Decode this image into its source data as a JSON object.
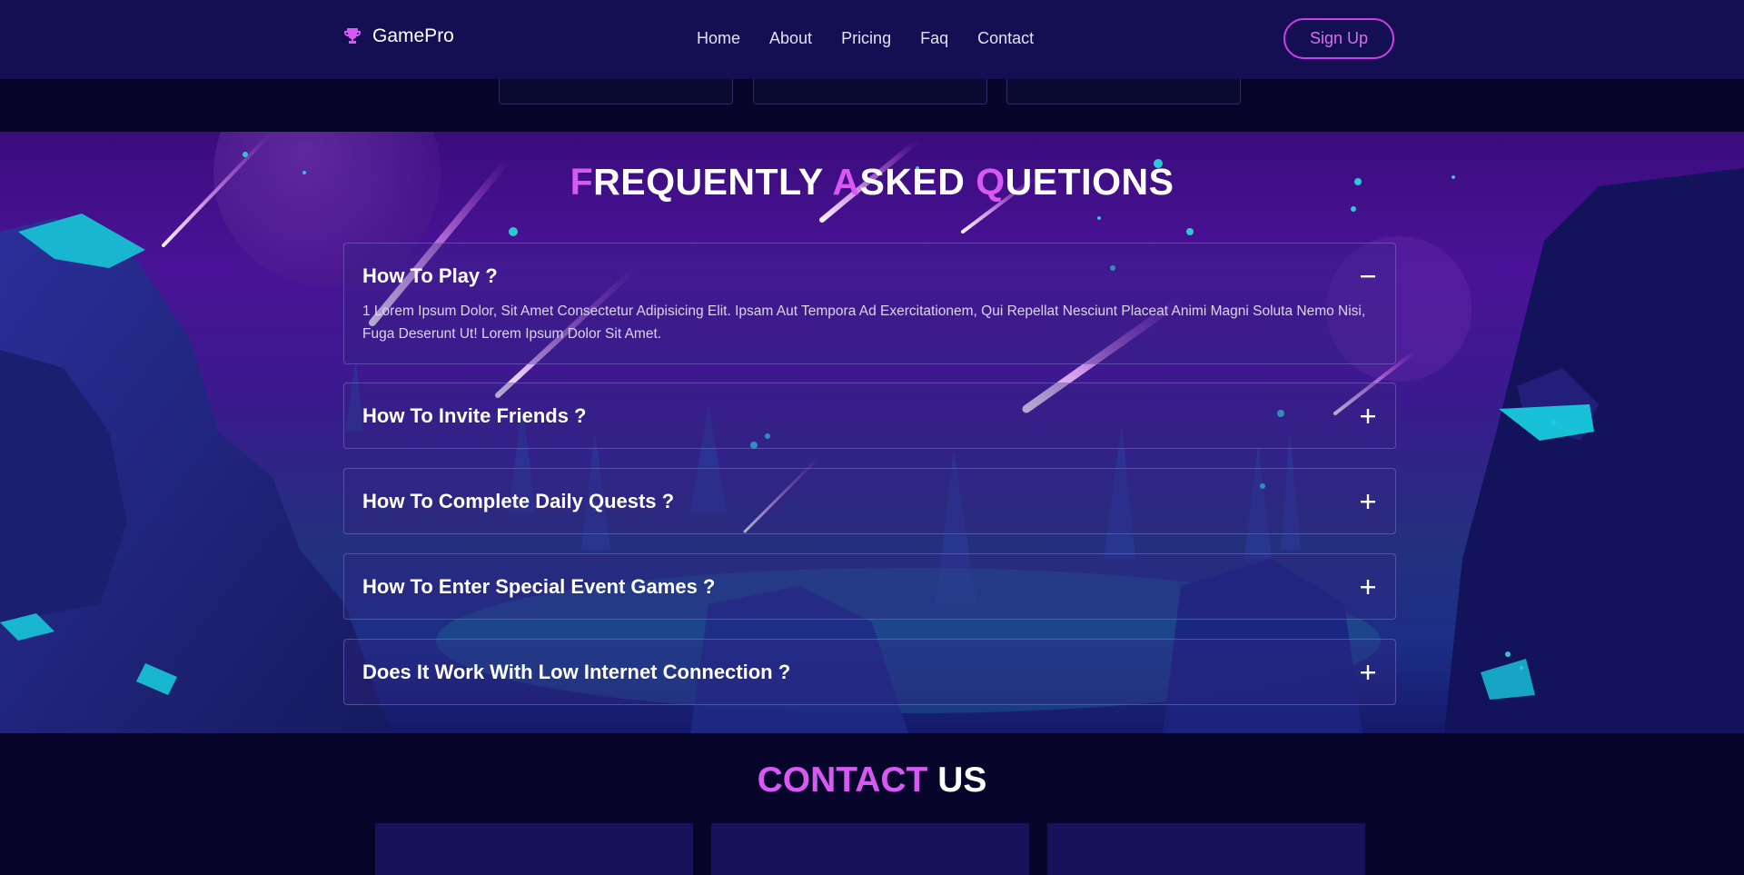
{
  "nav": {
    "brand": "GamePro",
    "logo_icon": "trophy-icon",
    "links": [
      "Home",
      "About",
      "Pricing",
      "Faq",
      "Contact"
    ],
    "signup_label": "Sign Up"
  },
  "faq": {
    "title_parts": [
      {
        "accent": "F",
        "rest": "REQUENTLY "
      },
      {
        "accent": "A",
        "rest": "SKED "
      },
      {
        "accent": "Q",
        "rest": "UETIONS"
      }
    ],
    "items": [
      {
        "question": "How To Play ?",
        "answer": "1 Lorem Ipsum Dolor, Sit Amet Consectetur Adipisicing Elit. Ipsam Aut Tempora Ad Exercitationem, Qui Repellat Nesciunt Placeat Animi Magni Soluta Nemo Nisi, Fuga Deserunt Ut! Lorem Ipsum Dolor Sit Amet.",
        "toggle": "−",
        "expanded": true
      },
      {
        "question": "How To Invite Friends ?",
        "toggle": "+",
        "expanded": false
      },
      {
        "question": "How To Complete Daily Quests ?",
        "toggle": "+",
        "expanded": false
      },
      {
        "question": "How To Enter Special Event Games ?",
        "toggle": "+",
        "expanded": false
      },
      {
        "question": "Does It Work With Low Internet Connection ?",
        "toggle": "+",
        "expanded": false
      }
    ]
  },
  "contact": {
    "title_accent": "CONTACT",
    "title_rest": " US"
  },
  "colors": {
    "accent": "#d858f3",
    "nav_bg": "#140e52",
    "page_bg": "#07062a",
    "button_border": "#c93ee5"
  }
}
